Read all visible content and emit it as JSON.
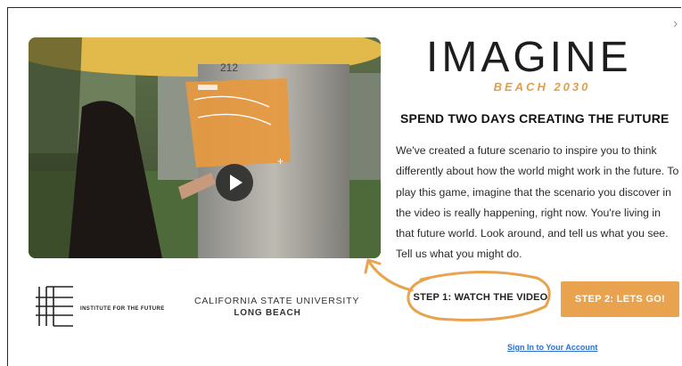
{
  "modal": {
    "close_icon": "chevron-right-icon",
    "logo_title": "IMAGINE",
    "logo_subtitle": "BEACH 2030",
    "headline": "SPEND TWO DAYS CREATING THE FUTURE",
    "description": "We've created a future scenario to inspire you to think differently about how the world might work in the future. To play this game, imagine that the scenario you discover in the video is really happening, right now. You're living in that future world. Look around, and tell us what you see. Tell us what you might do.",
    "video": {
      "play_icon": "play-icon",
      "pillar_label": "212"
    },
    "partners": {
      "iftf_label": "INSTITUTE FOR THE FUTURE",
      "csu_line1": "CALIFORNIA STATE UNIVERSITY",
      "csu_line2": "LONG BEACH"
    },
    "step1_label": "STEP 1: WATCH THE VIDEO",
    "step2_label": "STEP 2: LETS GO!",
    "signin_label": "Sign In to Your Account"
  },
  "colors": {
    "accent": "#e9a34f",
    "link": "#2b6fd0",
    "text": "#2a2a2a"
  }
}
